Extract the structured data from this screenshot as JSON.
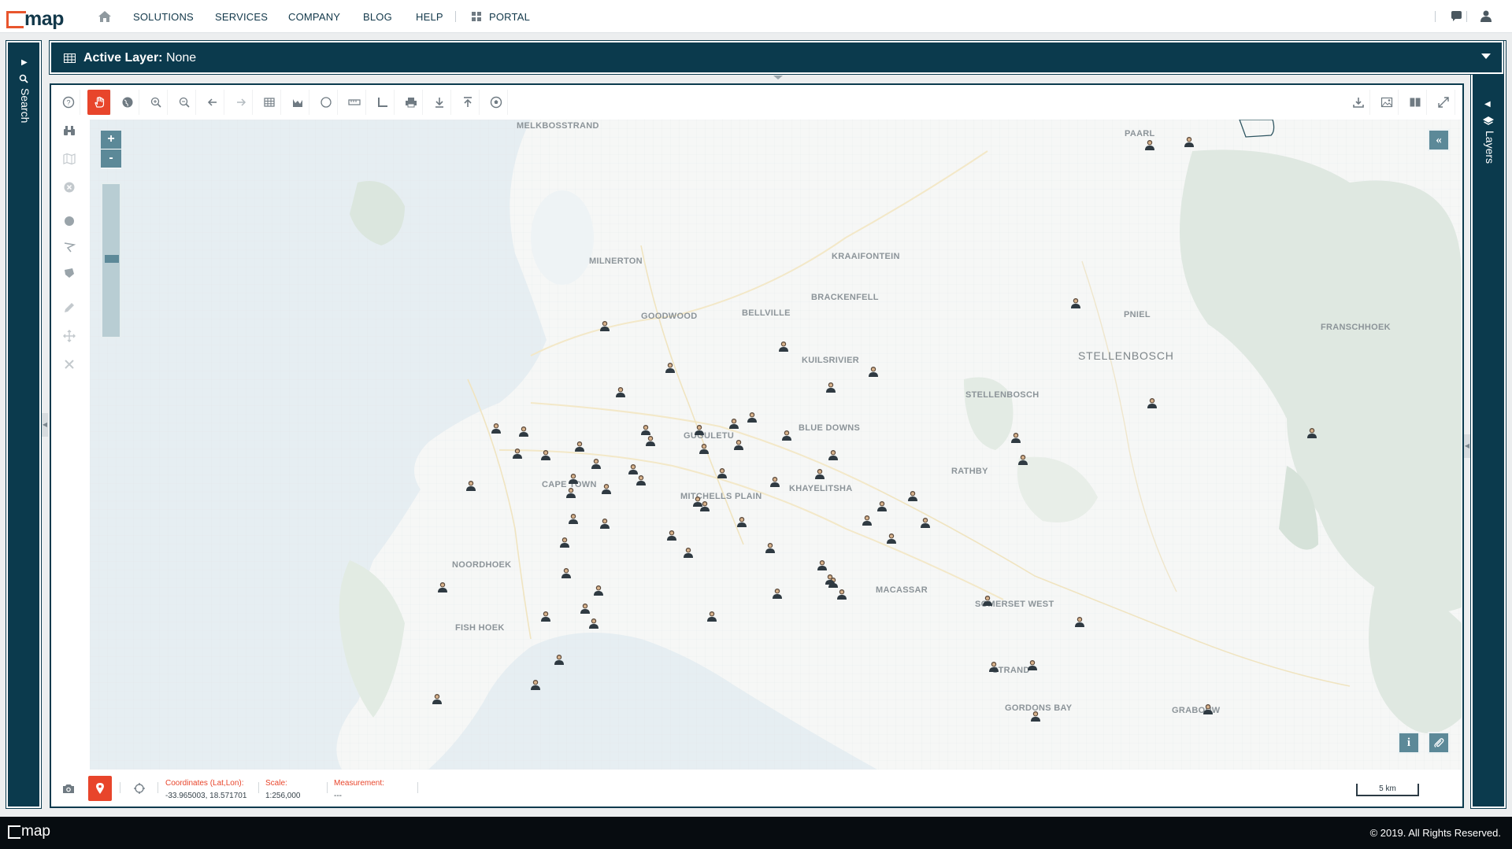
{
  "brand": {
    "name": "map",
    "accent": "#e8552d",
    "primary": "#0b3a4d"
  },
  "nav": {
    "items": [
      "SOLUTIONS",
      "SERVICES",
      "COMPANY",
      "BLOG",
      "HELP"
    ],
    "portal": "PORTAL",
    "icons": [
      "home-icon",
      "grid-icon",
      "chat-icon",
      "user-icon"
    ]
  },
  "search_panel": {
    "label": "Search"
  },
  "layers_panel": {
    "label": "Layers"
  },
  "layer_bar": {
    "title": "Active Layer:",
    "value": "None"
  },
  "toolbar": {
    "left_tools": [
      "help-icon",
      "pan-hand-icon",
      "globe-icon",
      "zoom-in-icon",
      "zoom-out-icon",
      "back-arrow-icon",
      "forward-arrow-icon",
      "table-icon",
      "chart-icon",
      "circle-select-icon",
      "ruler-icon",
      "angle-icon",
      "print-icon",
      "download-icon",
      "upload-icon",
      "soccer-ball-icon"
    ],
    "right_tools": [
      "export-icon",
      "image-icon",
      "split-view-icon",
      "fullscreen-icon"
    ],
    "rail_tools": [
      "binoculars-icon",
      "map-icon",
      "clear-icon",
      "circle-draw-icon",
      "polyline-icon",
      "polygon-icon",
      "pencil-icon",
      "move-icon",
      "delete-icon"
    ]
  },
  "map": {
    "zoom_in": "+",
    "zoom_out": "-",
    "zoom_level": 0.5,
    "collapse_button": "«",
    "info_button": "i",
    "places": [
      "MELKBOSSTRAND",
      "PAARL",
      "MILNERTON",
      "KRAAIFONTEIN",
      "BRACKENFELL",
      "GOODWOOD",
      "BELLVILLE",
      "PNIEL",
      "FRANSCHHOEK",
      "STELLENBOSCH",
      "KUILSRIVIER",
      "STELLENBOSCH",
      "BLUE DOWNS",
      "GUGULETU",
      "RATHBY",
      "CAPE TOWN",
      "MITCHELLS PLAIN",
      "KHAYELITSHA",
      "MACASSAR",
      "SOMERSET WEST",
      "NOORDHOEK",
      "FISH HOEK",
      "STRAND",
      "GORDONS BAY",
      "GRABOUW"
    ],
    "marker_icon": "person-marker-icon",
    "marker_count": 72
  },
  "status": {
    "coords_label": "Coordinates (Lat,Lon):",
    "coords_value": "-33.965003, 18.571701",
    "scale_label": "Scale:",
    "scale_value": "1:256,000",
    "measure_label": "Measurement:",
    "measure_value": "---",
    "scale_bar": "5 km"
  },
  "footer": {
    "logo": "map",
    "copyright": "© 2019. All Rights Reserved."
  }
}
